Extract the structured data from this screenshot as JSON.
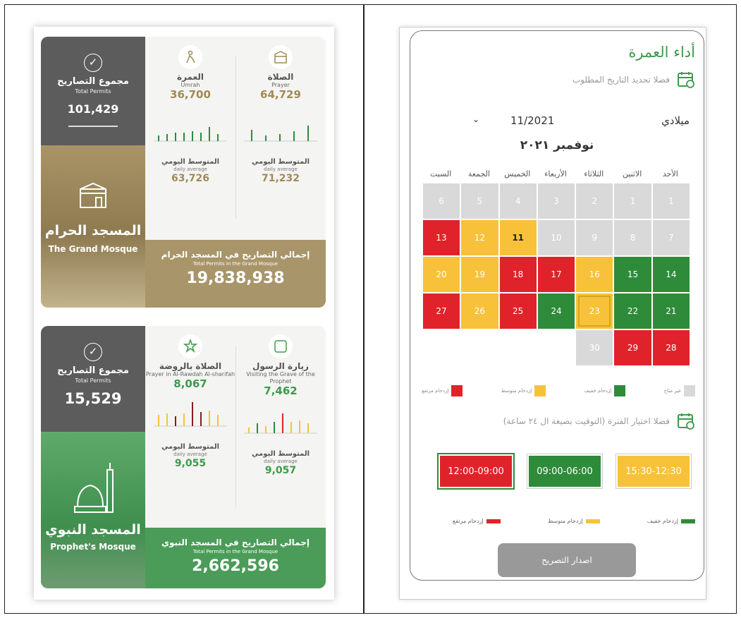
{
  "grand": {
    "total_ar": "مجموع التصاريح",
    "total_en": "Total Permits",
    "total": "101,429",
    "mosque_ar": "المسجد الحرام",
    "mosque_en": "The Grand Mosque",
    "prayer_ar": "الصلاة",
    "prayer_en": "Prayer",
    "prayer_num": "64,729",
    "umrah_ar": "العمرة",
    "umrah_en": "Umrah",
    "umrah_num": "36,700",
    "avg_ar": "المتوسط اليومي",
    "avg_en": "daily average",
    "prayer_avg": "71,232",
    "umrah_avg": "63,726",
    "sum_ar": "إجمالي التصاريح في المسجد الحرام",
    "sum_en": "Total Permits in the Grand Mosque",
    "sum": "19,838,938"
  },
  "prophet": {
    "total_ar": "مجموع التصاريح",
    "total_en": "Total Permits",
    "total": "15,529",
    "mosque_ar": "المسجد النبوي",
    "mosque_en": "Prophet's Mosque",
    "visit_ar": "زيارة الرسول",
    "visit_en": "Visiting the Grave of the Prophet",
    "visit_num": "7,462",
    "rawdah_ar": "الصلاة بالروضة",
    "rawdah_en": "Prayer in Al-Rawdah Al-sharifah",
    "rawdah_num": "8,067",
    "avg_ar": "المتوسط اليومي",
    "avg_en": "daily average",
    "visit_avg": "9,057",
    "rawdah_avg": "9,055",
    "sum_ar": "إجمالي التصاريح في المسجد النبوي",
    "sum_en": "Total Permits in the Grand Mosque",
    "sum": "2,662,596"
  },
  "app": {
    "title": "أداء العمرة",
    "pick_date": "فضلا تحديد التاريخ المطلوب",
    "calendar_type": "ميلادي",
    "month_value": "11/2021",
    "month_title": "نوفمبر ٢٠٢١",
    "days": [
      "الأحد",
      "الاثنين",
      "الثلاثاء",
      "الأربعاء",
      "الخميس",
      "الجمعة",
      "السبت"
    ],
    "legend": {
      "na": "غير متاح",
      "light": "إزدحام خفيف",
      "medium": "إزدحام متوسط",
      "high": "إزدحام مرتفع"
    },
    "pick_time": "فضلا اختيار الفترة (التوقيت بصيغة ال ٢٤ ساعة)",
    "slots": [
      "15:30-12:30",
      "09:00-06:00",
      "12:00-09:00"
    ],
    "issue_button": "اصدار التصريح"
  },
  "colors": {
    "green": "#2e8b3a",
    "yellow": "#f7c23a",
    "red": "#e0232a",
    "gray": "#d9d9d9",
    "gold": "#a89569"
  }
}
